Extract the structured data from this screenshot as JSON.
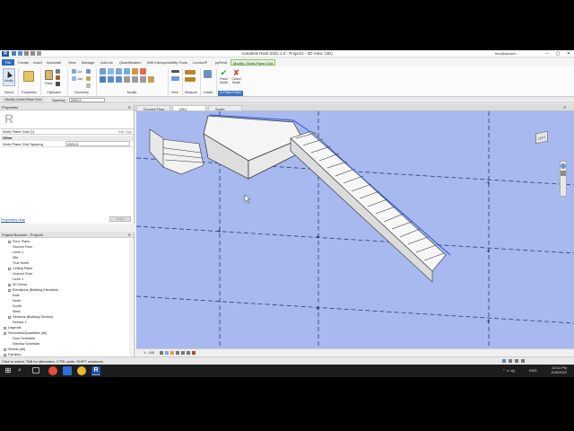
{
  "titlebar": {
    "app_icon": "R",
    "title": "Autodesk Revit 2021.1.3 - Project1 - 3D View: {3D}",
    "user": "kev@aplusrv..."
  },
  "ribbon_tabs": [
    "File",
    "Create",
    "Insert",
    "Annotate",
    "View",
    "Manage",
    "Add-Ins",
    "Quantification",
    "BIM Interoperability Tools",
    "Lumion®",
    "pyRevit",
    "Modify | Work Plane Grid"
  ],
  "ribbon": {
    "groups": [
      "Select",
      "Properties",
      "Clipboard",
      "Geometry",
      "Modify",
      "View",
      "Measure",
      "Create",
      "In-Place Editor"
    ],
    "buttons": {
      "modify": "Modify",
      "paste": "Paste",
      "cut": "Cut",
      "join": "Join",
      "finish_model": "Finish Model",
      "cancel_model": "Cancel Model"
    }
  },
  "options_bar": {
    "context": "Modify | Work Plane Grid",
    "spacing_label": "Spacing:",
    "spacing_value": "2000.0"
  },
  "properties": {
    "header": "Properties",
    "type_selector": "Work Plane Grid (1)",
    "edit_type": "Edit Type",
    "section": "Other",
    "rows": [
      {
        "name": "Work Plane Grid Spacing",
        "value": "2000.0"
      }
    ],
    "help": "Properties help",
    "apply": "Apply"
  },
  "browser": {
    "header": "Project Browser - Project1",
    "items": [
      {
        "label": "Floor Plans",
        "level": 1
      },
      {
        "label": "Ground Floor",
        "level": 2
      },
      {
        "label": "Level 1",
        "level": 2
      },
      {
        "label": "Site",
        "level": 2
      },
      {
        "label": "True North",
        "level": 2
      },
      {
        "label": "Ceiling Plans",
        "level": 1
      },
      {
        "label": "Ground Floor",
        "level": 2
      },
      {
        "label": "Level 1",
        "level": 2
      },
      {
        "label": "3D Views",
        "level": 1
      },
      {
        "label": "Elevations (Building Elevation)",
        "level": 1
      },
      {
        "label": "East",
        "level": 2
      },
      {
        "label": "North",
        "level": 2
      },
      {
        "label": "South",
        "level": 2
      },
      {
        "label": "West",
        "level": 2
      },
      {
        "label": "Sections (Building Section)",
        "level": 1
      },
      {
        "label": "Section 1",
        "level": 2
      },
      {
        "label": "Legends",
        "level": 0
      },
      {
        "label": "Schedules/Quantities (all)",
        "level": 0
      },
      {
        "label": "Door Schedule",
        "level": 2
      },
      {
        "label": "Window Schedule",
        "level": 2
      },
      {
        "label": "Sheets (all)",
        "level": 0
      },
      {
        "label": "Families",
        "level": 0
      }
    ]
  },
  "view_tabs": [
    "Ground Floor",
    "{3D}",
    "South"
  ],
  "view_cube_label": "LEFT",
  "view_control": {
    "scale": "1 : 100"
  },
  "status": {
    "text": "Click to select, TAB for alternates, CTRL adds, SHIFT unselects."
  },
  "taskbar": {
    "language": "ENG",
    "time": "10:14 PM",
    "date": "10/6/2022"
  },
  "colors": {
    "canvas": "#a7b9ef",
    "accent": "#2a6ebb",
    "ribbon_active": "#e6f3d8"
  }
}
